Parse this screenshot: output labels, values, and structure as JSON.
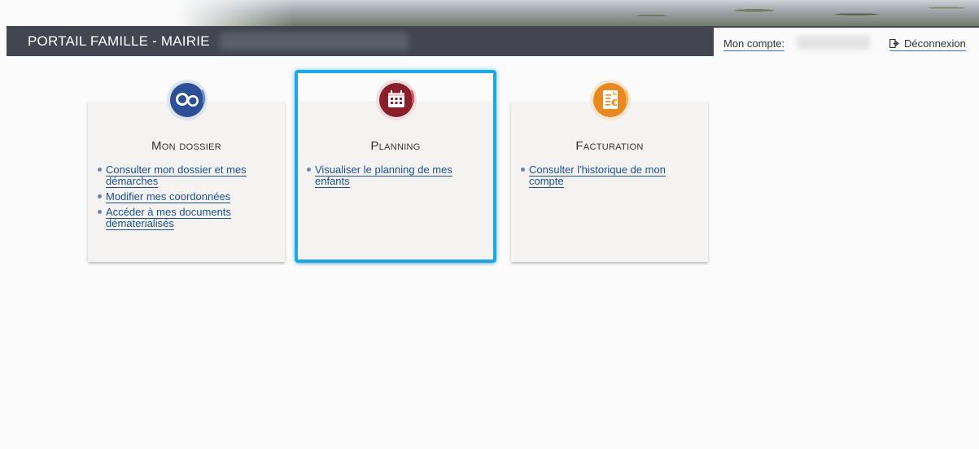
{
  "header": {
    "brand": "PORTAIL FAMILLE - MAIRIE",
    "account_label": "Mon compte:",
    "logout_label": "Déconnexion"
  },
  "cards": [
    {
      "title": "Mon dossier",
      "icon": "family-icon",
      "color": "#2c4f95",
      "links": [
        "Consulter mon dossier et mes démarches",
        "Modifier mes coordonnées",
        "Accéder à mes documents dématerialisés"
      ]
    },
    {
      "title": "Planning",
      "icon": "calendar-icon",
      "color": "#8a1f2c",
      "links": [
        "Visualiser le planning de mes enfants"
      ]
    },
    {
      "title": "Facturation",
      "icon": "invoice-euro-icon",
      "color": "#e7891e",
      "links": [
        "Consulter l'historique de mon compte"
      ]
    }
  ],
  "accent": "#1ea7e1"
}
